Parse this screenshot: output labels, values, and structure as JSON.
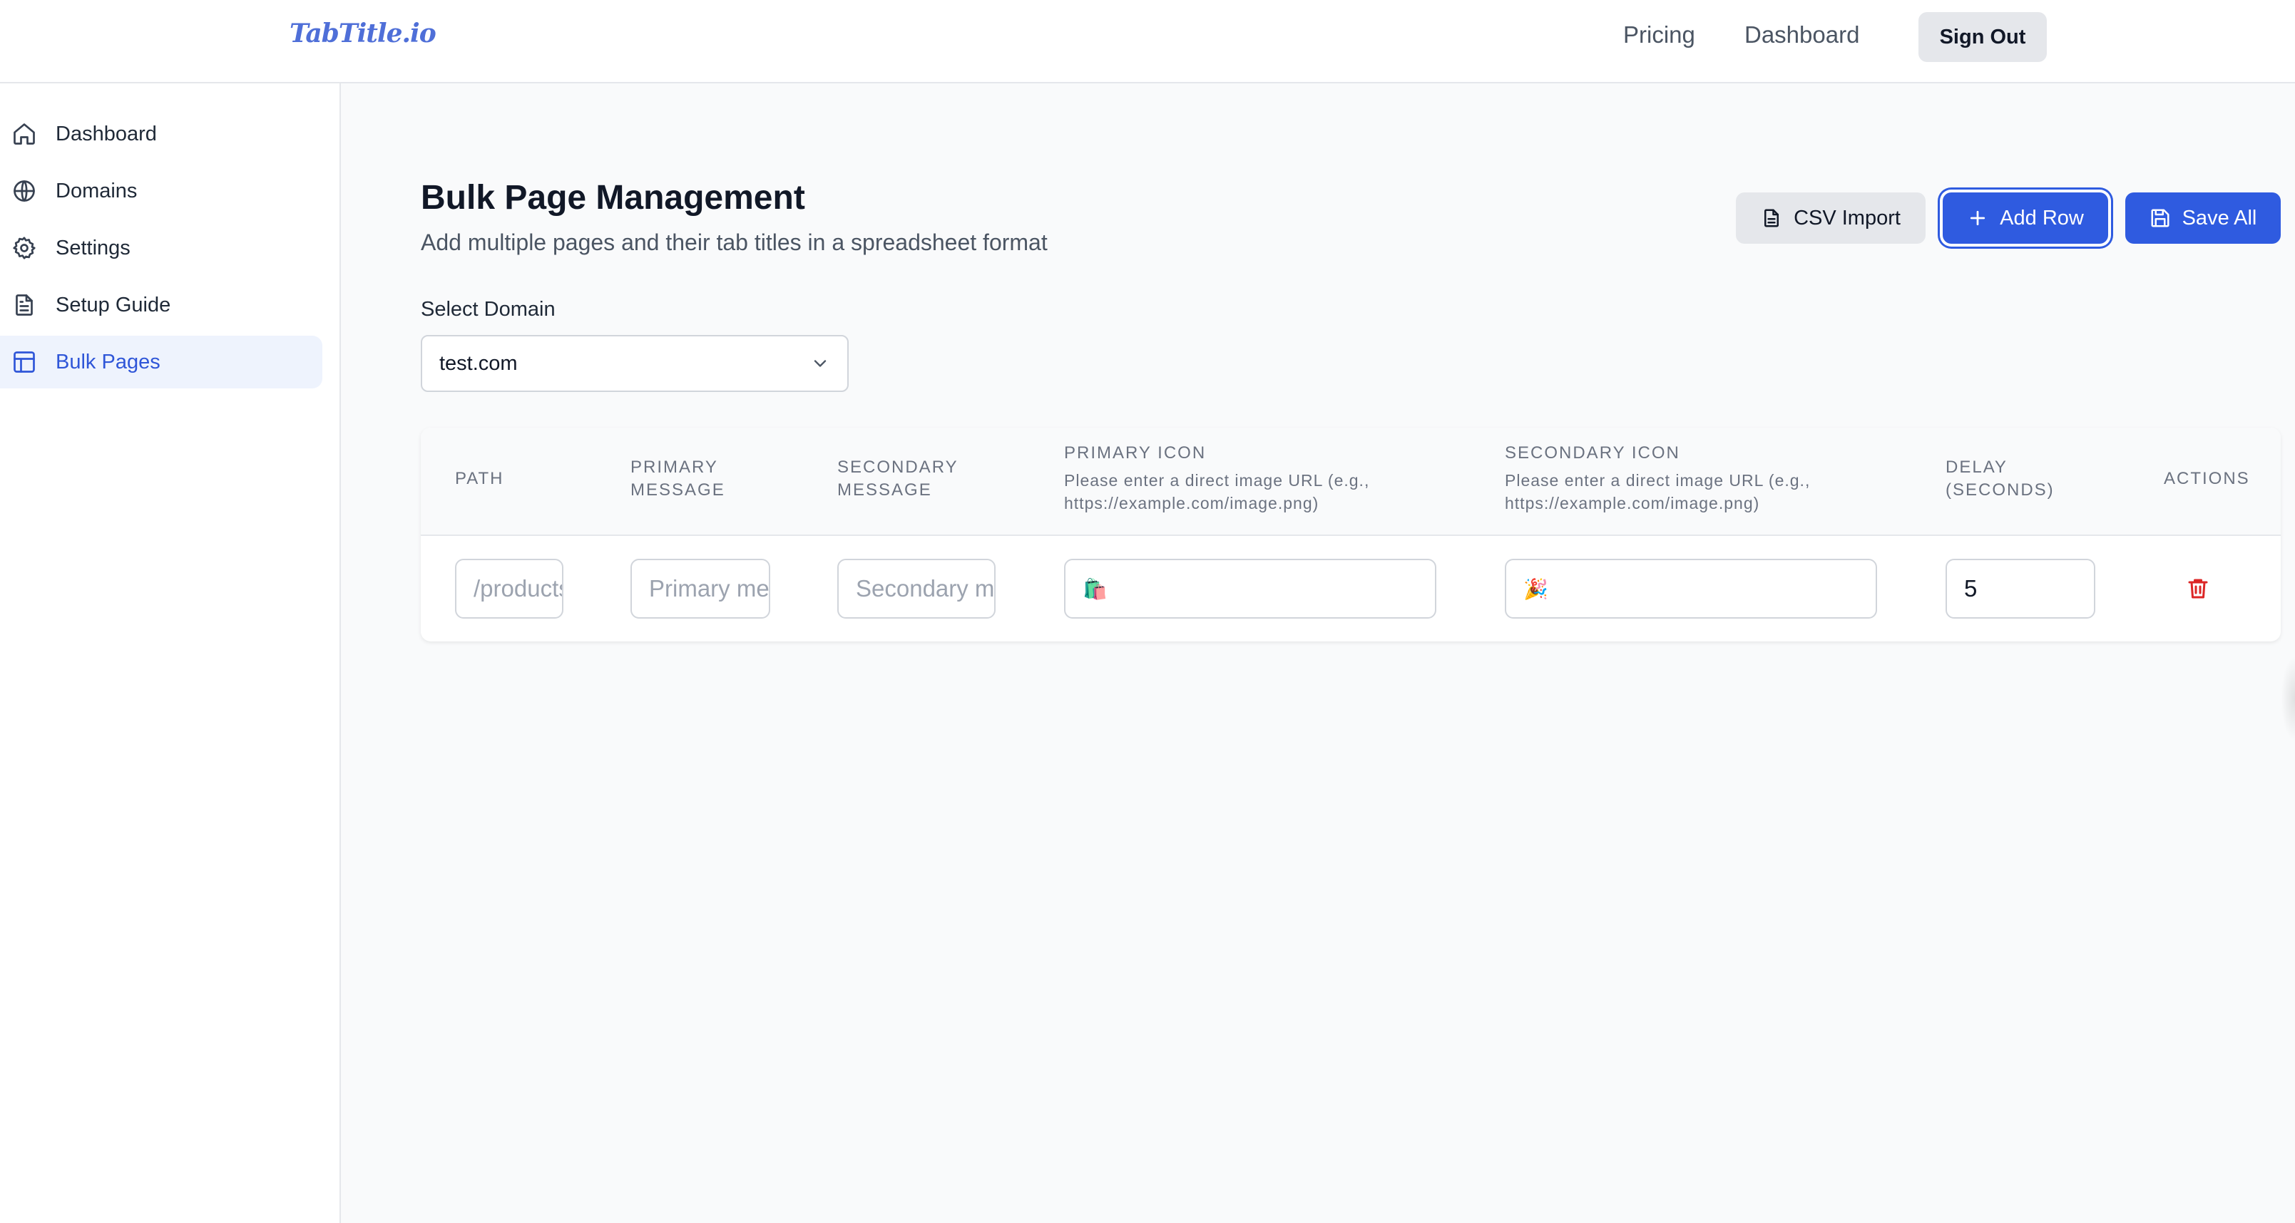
{
  "header": {
    "logo": "TabTitle.io",
    "nav": [
      {
        "label": "Pricing"
      },
      {
        "label": "Dashboard"
      }
    ],
    "sign_out": "Sign Out"
  },
  "sidebar": {
    "items": [
      {
        "label": "Dashboard",
        "icon": "home-icon",
        "active": false
      },
      {
        "label": "Domains",
        "icon": "globe-icon",
        "active": false
      },
      {
        "label": "Settings",
        "icon": "gear-icon",
        "active": false
      },
      {
        "label": "Setup Guide",
        "icon": "document-icon",
        "active": false
      },
      {
        "label": "Bulk Pages",
        "icon": "table-icon",
        "active": true
      }
    ]
  },
  "main": {
    "title": "Bulk Page Management",
    "subtitle": "Add multiple pages and their tab titles in a spreadsheet format",
    "buttons": {
      "csv_import": "CSV Import",
      "add_row": "Add Row",
      "save_all": "Save All"
    },
    "domain": {
      "label": "Select Domain",
      "selected": "test.com"
    },
    "table": {
      "columns": [
        {
          "label": "PATH"
        },
        {
          "label": "PRIMARY MESSAGE"
        },
        {
          "label": "SECONDARY MESSAGE"
        },
        {
          "label": "PRIMARY ICON",
          "hint": "Please enter a direct image URL (e.g., https://example.com/image.png)"
        },
        {
          "label": "SECONDARY ICON",
          "hint": "Please enter a direct image URL (e.g., https://example.com/image.png)"
        },
        {
          "label": "DELAY (SECONDS)"
        },
        {
          "label": "ACTIONS"
        }
      ],
      "rows": [
        {
          "path": {
            "value": "",
            "placeholder": "/products"
          },
          "primary_message": {
            "value": "",
            "placeholder": "Primary message"
          },
          "secondary_message": {
            "value": "",
            "placeholder": "Secondary message"
          },
          "primary_icon": {
            "value": "🛍️"
          },
          "secondary_icon": {
            "value": "🎉"
          },
          "delay": {
            "value": "5"
          }
        }
      ]
    }
  },
  "colors": {
    "accent": "#2f5be0",
    "sidebar_active_bg": "#eef3fd",
    "danger": "#dc2626"
  }
}
